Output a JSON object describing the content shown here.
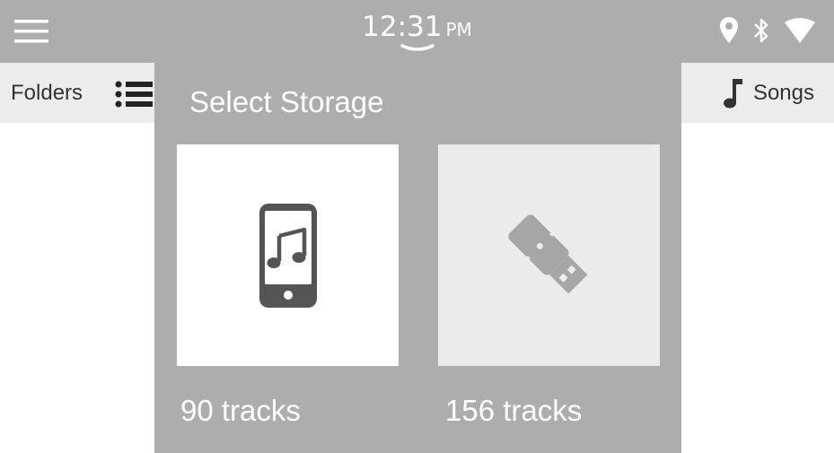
{
  "status_bar": {
    "time": "12:31",
    "ampm": "PM",
    "icons": [
      "menu-icon",
      "location-icon",
      "bluetooth-icon",
      "wifi-icon",
      "chevron-down-icon"
    ]
  },
  "sub_header": {
    "folders_label": "Folders",
    "songs_label": "Songs",
    "icons": [
      "list-icon",
      "music-note-icon"
    ]
  },
  "modal": {
    "title": "Select Storage",
    "options": [
      {
        "icon": "phone-music-icon",
        "tracks": "90 tracks"
      },
      {
        "icon": "usb-drive-icon",
        "tracks": "156 tracks"
      }
    ]
  },
  "colors": {
    "bar": "#adadad",
    "sub_header": "#ececec",
    "modal": "#adadad",
    "icon_dark": "#555555",
    "icon_usb": "#a6a6a6",
    "text_light": "#ffffff",
    "text_dark": "#333333"
  }
}
